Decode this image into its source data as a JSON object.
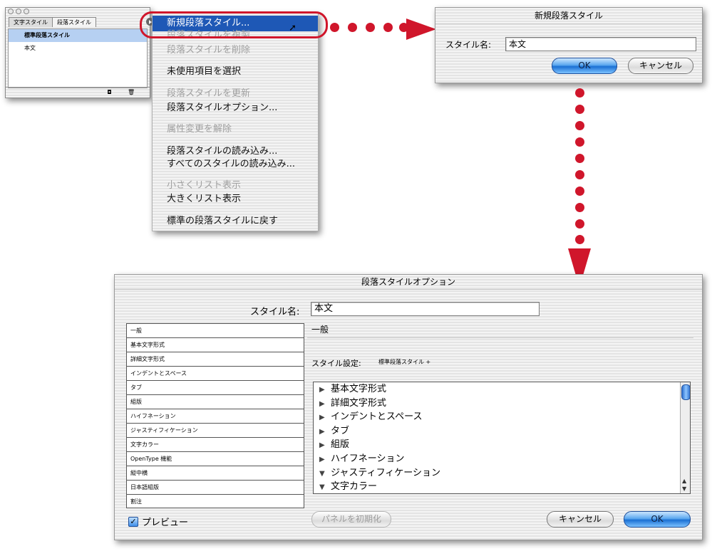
{
  "palette": {
    "tabs": [
      "文字スタイル",
      "段落スタイル"
    ],
    "styles": [
      "標準段落スタイル",
      "本文"
    ]
  },
  "menu": {
    "items": [
      {
        "label": "新規段落スタイル...",
        "state": "highlighted"
      },
      {
        "label": "段落スタイルを複製",
        "state": "disabled"
      },
      {
        "label": "段落スタイルを削除",
        "state": "disabled"
      },
      {
        "label": "未使用項目を選択",
        "state": "enabled"
      },
      {
        "label": "段落スタイルを更新",
        "state": "disabled"
      },
      {
        "label": "段落スタイルオプション...",
        "state": "enabled"
      },
      {
        "label": "属性変更を解除",
        "state": "disabled"
      },
      {
        "label": "段落スタイルの読み込み...",
        "state": "enabled"
      },
      {
        "label": "すべてのスタイルの読み込み...",
        "state": "enabled"
      },
      {
        "label": "小さくリスト表示",
        "state": "disabled"
      },
      {
        "label": "大きくリスト表示",
        "state": "enabled"
      },
      {
        "label": "標準の段落スタイルに戻す",
        "state": "enabled"
      }
    ]
  },
  "new_dialog": {
    "title": "新規段落スタイル",
    "name_label": "スタイル名:",
    "name_value": "本文",
    "ok": "OK",
    "cancel": "キャンセル"
  },
  "options_dialog": {
    "title": "段落スタイルオプション",
    "name_label": "スタイル名:",
    "name_value": "本文",
    "categories": [
      "一般",
      "基本文字形式",
      "詳細文字形式",
      "インデントとスペース",
      "タブ",
      "組版",
      "ハイフネーション",
      "ジャスティフィケーション",
      "文字カラー",
      "OpenType 機能",
      "縦中横",
      "日本語組版",
      "割注"
    ],
    "section_title": "一般",
    "style_settings_label": "スタイル設定:",
    "style_settings_value": "標準段落スタイル +",
    "summary": [
      {
        "label": "基本文字形式",
        "expanded": false
      },
      {
        "label": "詳細文字形式",
        "expanded": false
      },
      {
        "label": "インデントとスペース",
        "expanded": false
      },
      {
        "label": "タブ",
        "expanded": false
      },
      {
        "label": "組版",
        "expanded": false
      },
      {
        "label": "ハイフネーション",
        "expanded": false
      },
      {
        "label": "ジャスティフィケーション",
        "expanded": true
      },
      {
        "label": "文字カラー",
        "expanded": true
      }
    ],
    "preview_label": "プレビュー",
    "preview_checked": true,
    "reset_panel": "パネルを初期化",
    "cancel": "キャンセル",
    "ok": "OK"
  },
  "colors": {
    "highlight_ring": "#d0162b",
    "menu_highlight": "#1e58b6",
    "default_button": "#1b70d4"
  }
}
